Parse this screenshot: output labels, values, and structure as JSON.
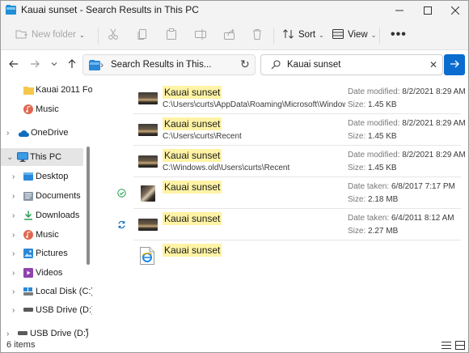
{
  "window": {
    "title": "Kauai sunset - Search Results in This PC"
  },
  "toolbar": {
    "new_folder": "New folder",
    "sort": "Sort",
    "view": "View",
    "more": "•••"
  },
  "address": {
    "path": "Search Results in This...",
    "search_value": "Kauai sunset"
  },
  "sidebar": {
    "items": [
      {
        "label": "Kauai 2011 For",
        "icon": "folder-icon"
      },
      {
        "label": "Music",
        "icon": "music-icon"
      },
      {
        "label": "OneDrive",
        "icon": "cloud-icon"
      },
      {
        "label": "This PC",
        "icon": "computer-icon"
      },
      {
        "label": "Desktop",
        "icon": "desktop-icon"
      },
      {
        "label": "Documents",
        "icon": "documents-icon"
      },
      {
        "label": "Downloads",
        "icon": "download-icon"
      },
      {
        "label": "Music",
        "icon": "music-icon"
      },
      {
        "label": "Pictures",
        "icon": "pictures-icon"
      },
      {
        "label": "Videos",
        "icon": "videos-icon"
      },
      {
        "label": "Local Disk (C:)",
        "icon": "drive-icon"
      },
      {
        "label": "USB Drive (D:)",
        "icon": "usb-drive-icon"
      },
      {
        "label": "USB Drive (D:)",
        "icon": "usb-drive-icon"
      }
    ]
  },
  "results": [
    {
      "name": "Kauai sunset",
      "path": "C:\\Users\\curts\\AppData\\Roaming\\Microsoft\\Windows...",
      "meta1_label": "Date modified:",
      "meta1_value": "8/2/2021 8:29 AM",
      "meta2_label": "Size:",
      "meta2_value": "1.45 KB",
      "status": ""
    },
    {
      "name": "Kauai sunset",
      "path": "C:\\Users\\curts\\Recent",
      "meta1_label": "Date modified:",
      "meta1_value": "8/2/2021 8:29 AM",
      "meta2_label": "Size:",
      "meta2_value": "1.45 KB",
      "status": ""
    },
    {
      "name": "Kauai sunset",
      "path": "C:\\Windows.old\\Users\\curts\\Recent",
      "meta1_label": "Date modified:",
      "meta1_value": "8/2/2021 8:29 AM",
      "meta2_label": "Size:",
      "meta2_value": "1.45 KB",
      "status": ""
    },
    {
      "name": "Kauai sunset",
      "path": "",
      "meta1_label": "Date taken:",
      "meta1_value": "6/8/2017 7:17 PM",
      "meta2_label": "Size:",
      "meta2_value": "2.18 MB",
      "status": "available-icon"
    },
    {
      "name": "Kauai sunset",
      "path": "",
      "meta1_label": "Date taken:",
      "meta1_value": "6/4/2011 8:12 AM",
      "meta2_label": "Size:",
      "meta2_value": "2.27 MB",
      "status": "sync-icon"
    },
    {
      "name": "Kauai sunset",
      "path": "",
      "meta1_label": "",
      "meta1_value": "",
      "meta2_label": "",
      "meta2_value": "",
      "status": ""
    }
  ],
  "status": {
    "count": "6 items"
  },
  "colors": {
    "accent": "#0a6ccf",
    "highlight": "#fff3a5"
  }
}
